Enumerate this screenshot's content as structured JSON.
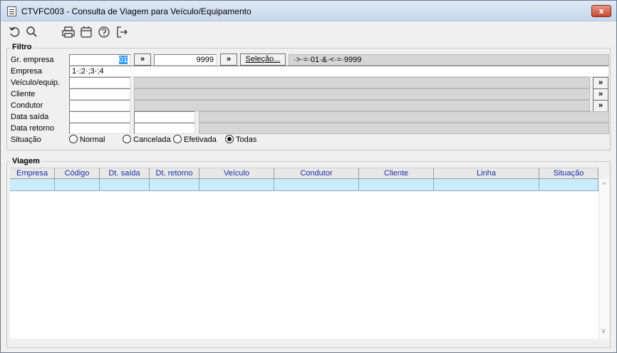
{
  "window": {
    "title": "CTVFC003 - Consulta de Viagem para Veículo/Equipamento",
    "close_label": "x"
  },
  "toolbar": {
    "icons": [
      "undo-icon",
      "search-icon",
      "print-icon",
      "calendar-icon",
      "help-icon",
      "exit-icon"
    ]
  },
  "filtro": {
    "legend": "Filtro",
    "labels": {
      "gr_empresa": "Gr. empresa",
      "empresa": "Empresa",
      "veiculo": "Veículo/equip.",
      "cliente": "Cliente",
      "condutor": "Condutor",
      "data_saida": "Data saída",
      "data_retorno": "Data retorno",
      "situacao": "Situação"
    },
    "gr_empresa_from": "01",
    "gr_empresa_to": "9999",
    "range_button": "»",
    "selecao_button": "Seleção...",
    "selecao_expression": "·>·=·01·&·<·=·9999",
    "empresa_value": "1·;2·;3·;4",
    "lookup_button": "»",
    "situacao_options": [
      "Normal",
      "Cancelada",
      "Efetivada",
      "Todas"
    ],
    "situacao_selected": "Todas"
  },
  "viagem": {
    "legend": "Viagem",
    "columns": [
      "Empresa",
      "Código",
      "Dt. saída",
      "Dt. retorno",
      "Veículo",
      "Condutor",
      "Cliente",
      "Linha",
      "Situação"
    ],
    "scroll_up": "^",
    "scroll_down": "v"
  },
  "colors": {
    "header_text": "#1b2fa6",
    "row_highlight": "#c9ecff",
    "selection": "#3399ff"
  }
}
